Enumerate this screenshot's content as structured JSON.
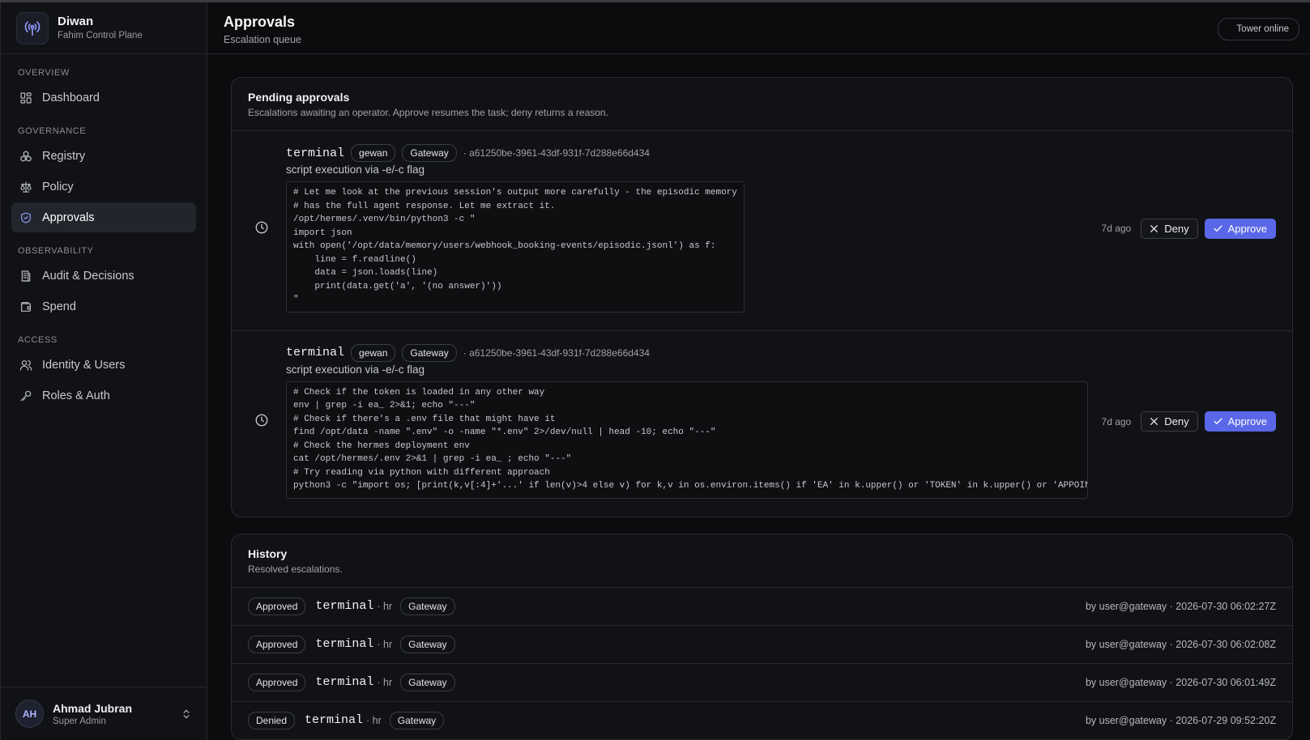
{
  "brand": {
    "name": "Diwan",
    "subtitle": "Fahim Control Plane"
  },
  "nav": {
    "sections": [
      {
        "label": "OVERVIEW",
        "items": [
          {
            "label": "Dashboard",
            "icon": "dashboard-icon"
          }
        ]
      },
      {
        "label": "GOVERNANCE",
        "items": [
          {
            "label": "Registry",
            "icon": "registry-icon"
          },
          {
            "label": "Policy",
            "icon": "scale-icon"
          },
          {
            "label": "Approvals",
            "icon": "shield-icon",
            "active": true
          }
        ]
      },
      {
        "label": "OBSERVABILITY",
        "items": [
          {
            "label": "Audit & Decisions",
            "icon": "audit-icon"
          },
          {
            "label": "Spend",
            "icon": "wallet-icon"
          }
        ]
      },
      {
        "label": "ACCESS",
        "items": [
          {
            "label": "Identity & Users",
            "icon": "users-icon"
          },
          {
            "label": "Roles & Auth",
            "icon": "key-icon"
          }
        ]
      }
    ]
  },
  "user": {
    "initials": "AH",
    "name": "Ahmad Jubran",
    "role": "Super Admin"
  },
  "header": {
    "title": "Approvals",
    "subtitle": "Escalation queue",
    "status": "Tower online"
  },
  "pending": {
    "title": "Pending approvals",
    "description": "Escalations awaiting an operator. Approve resumes the task; deny returns a reason.",
    "items": [
      {
        "tool": "terminal",
        "agent": "gewan",
        "source": "Gateway",
        "id": "· a61250be-3961-43df-931f-7d288e66d434",
        "reason": "script execution via -e/-c flag",
        "code": "# Let me look at the previous session's output more carefully - the episodic memory\n# has the full agent response. Let me extract it.\n/opt/hermes/.venv/bin/python3 -c \"\nimport json\nwith open('/opt/data/memory/users/webhook_booking-events/episodic.jsonl') as f:\n    line = f.readline()\n    data = json.loads(line)\n    print(data.get('a', '(no answer)'))\n\"",
        "ago": "7d ago",
        "deny": "Deny",
        "approve": "Approve"
      },
      {
        "tool": "terminal",
        "agent": "gewan",
        "source": "Gateway",
        "id": "· a61250be-3961-43df-931f-7d288e66d434",
        "reason": "script execution via -e/-c flag",
        "code": "# Check if the token is loaded in any other way\nenv | grep -i ea_ 2>&1; echo \"---\"\n# Check if there's a .env file that might have it\nfind /opt/data -name \".env\" -o -name \"*.env\" 2>/dev/null | head -10; echo \"---\"\n# Check the hermes deployment env\ncat /opt/hermes/.env 2>&1 | grep -i ea_ ; echo \"---\"\n# Try reading via python with different approach\npython3 -c \"import os; [print(k,v[:4]+'...' if len(v)>4 else v) for k,v in os.environ.items() if 'EA' in k.upper() or 'TOKEN' in k.upper() or 'APPOINTMENT' in k.upper()]\"",
        "ago": "7d ago",
        "deny": "Deny",
        "approve": "Approve"
      }
    ]
  },
  "history": {
    "title": "History",
    "description": "Resolved escalations.",
    "rows": [
      {
        "status": "Approved",
        "tool": "terminal",
        "agent": "· hr",
        "source": "Gateway",
        "by": "by user@gateway · 2026-07-30 06:02:27Z"
      },
      {
        "status": "Approved",
        "tool": "terminal",
        "agent": "· hr",
        "source": "Gateway",
        "by": "by user@gateway · 2026-07-30 06:02:08Z"
      },
      {
        "status": "Approved",
        "tool": "terminal",
        "agent": "· hr",
        "source": "Gateway",
        "by": "by user@gateway · 2026-07-30 06:01:49Z"
      },
      {
        "status": "Denied",
        "tool": "terminal",
        "agent": "· hr",
        "source": "Gateway",
        "by": "by user@gateway · 2026-07-29 09:52:20Z"
      }
    ]
  },
  "colors": {
    "accent": "#5a67e8",
    "background": "#0b0c0e",
    "panel": "#111215"
  }
}
